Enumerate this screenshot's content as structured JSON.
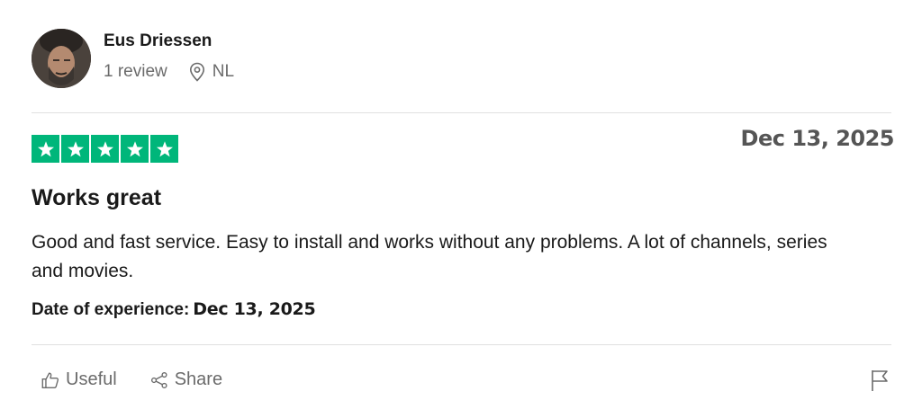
{
  "reviewer": {
    "name": "Eus Driessen",
    "review_count": "1 review",
    "country": "NL"
  },
  "review": {
    "rating": 5,
    "date": "Dec 13, 2025",
    "title": "Works great",
    "body": "Good and fast service. Easy to install and works without any problems. A lot of channels, series and movies.",
    "experience_label": "Date of experience:",
    "experience_date": "Dec 13, 2025"
  },
  "actions": {
    "useful_label": "Useful",
    "share_label": "Share"
  },
  "colors": {
    "star_green": "#00b67a",
    "muted_text": "#6b6b6b"
  }
}
